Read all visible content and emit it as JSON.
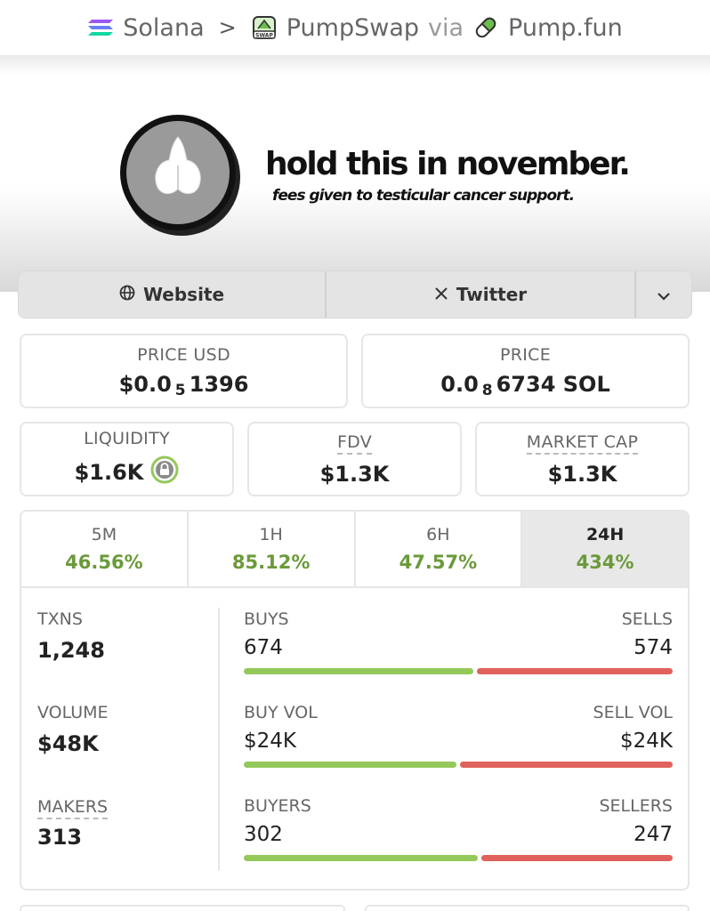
{
  "breadcrumb": {
    "chain": "Solana",
    "separator": ">",
    "dex": "PumpSwap",
    "via": "via",
    "launchpad": "Pump.fun"
  },
  "banner": {
    "headline": "hold this in november.",
    "subline": "fees given to testicular cancer support."
  },
  "links": {
    "website": "Website",
    "twitter": "Twitter"
  },
  "price_usd": {
    "label": "PRICE USD",
    "prefix": "$0.0",
    "zeros": "5",
    "digits": "1396"
  },
  "price_native": {
    "label": "PRICE",
    "prefix": "0.0",
    "zeros": "8",
    "digits": "6734 SOL"
  },
  "liquidity": {
    "label": "LIQUIDITY",
    "value": "$1.6K"
  },
  "fdv": {
    "label": "FDV",
    "value": "$1.3K"
  },
  "market_cap": {
    "label": "MARKET CAP",
    "value": "$1.3K"
  },
  "tabs": [
    {
      "label": "5M",
      "value": "46.56%"
    },
    {
      "label": "1H",
      "value": "85.12%"
    },
    {
      "label": "6H",
      "value": "47.57%"
    },
    {
      "label": "24H",
      "value": "434%"
    }
  ],
  "active_tab": "24H",
  "stats": {
    "txns": {
      "label": "TXNS",
      "value": "1,248"
    },
    "volume": {
      "label": "VOLUME",
      "value": "$48K"
    },
    "makers": {
      "label": "MAKERS",
      "value": "313"
    },
    "buys": {
      "label": "BUYS",
      "value": "674",
      "count": 674
    },
    "sells": {
      "label": "SELLS",
      "value": "574",
      "count": 574
    },
    "buy_vol": {
      "label": "BUY VOL",
      "value": "$24K",
      "share": 0.5
    },
    "sell_vol": {
      "label": "SELL VOL",
      "value": "$24K",
      "share": 0.5
    },
    "buyers": {
      "label": "BUYERS",
      "value": "302",
      "count": 302
    },
    "sellers": {
      "label": "SELLERS",
      "value": "247",
      "count": 247
    }
  },
  "colors": {
    "positive": "#6a9a3a",
    "buy_bar": "#94c85a",
    "sell_bar": "#e0625c"
  }
}
